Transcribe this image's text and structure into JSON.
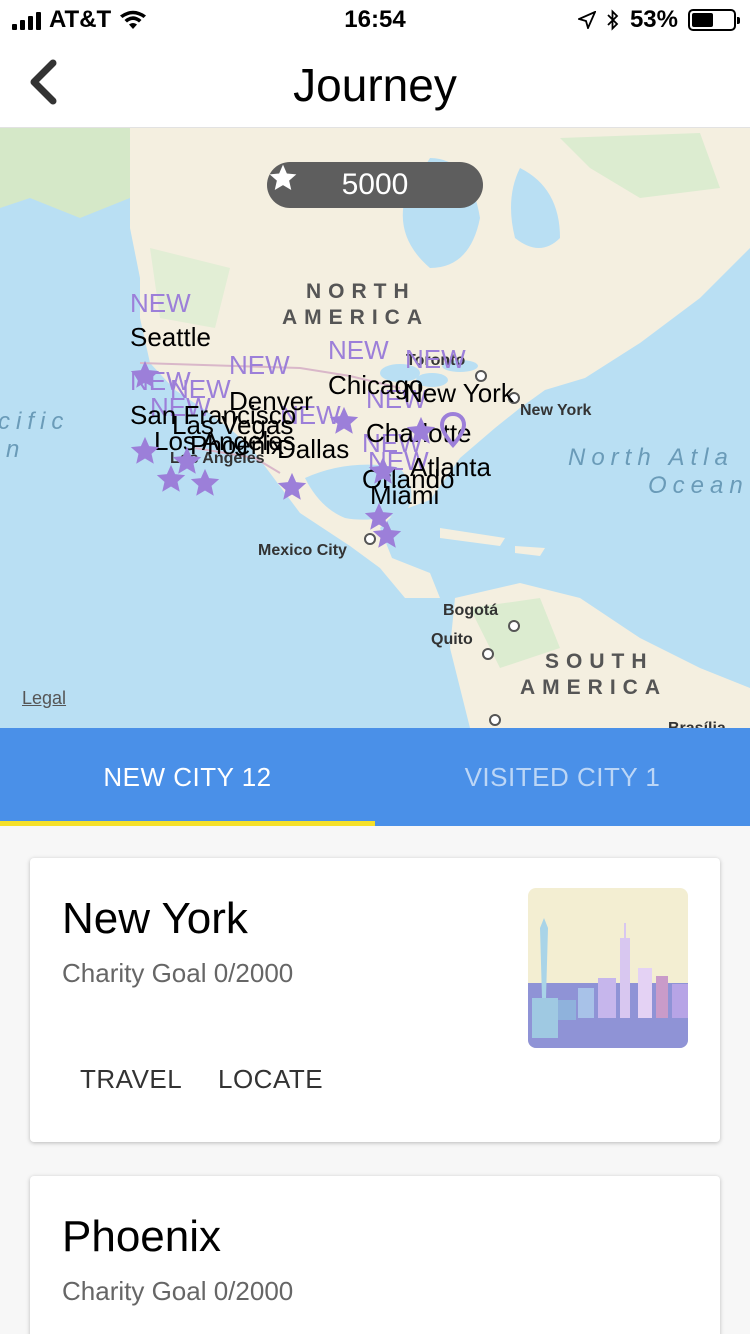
{
  "status_bar": {
    "carrier": "AT&T",
    "time": "16:54",
    "battery": "53%",
    "battery_level": 0.53
  },
  "nav": {
    "title": "Journey",
    "back_icon": "chevron-left-icon"
  },
  "map": {
    "stars_balance": "5000",
    "star_icon": "star-icon",
    "legal": "Legal",
    "regions": [
      "NORTH",
      "AMERICA",
      "SOUTH",
      "AMERICA"
    ],
    "oceans": [
      "cific",
      "n",
      "North Atla",
      "Ocean"
    ],
    "base_cities": [
      "Toronto",
      "New York",
      "Mexico City",
      "Bogotá",
      "Quito",
      "Los Angeles",
      "Brasília"
    ],
    "new_tag": "NEW",
    "journey_cities": [
      "Seattle",
      "San Francisco",
      "Las Vegas",
      "Los Angeles",
      "Phoenix",
      "Denver",
      "Dallas",
      "Chicago",
      "New York",
      "Charlotte",
      "Atlanta",
      "Orlando",
      "Miami"
    ],
    "marker_color": "#9c7fd9"
  },
  "tabs": [
    {
      "label": "NEW CITY 12",
      "active": true
    },
    {
      "label": "VISITED CITY 1",
      "active": false
    }
  ],
  "tab_indicator_color": "#f5e02a",
  "tab_bar_color": "#4a90e8",
  "cards": [
    {
      "title": "New York",
      "subtitle": "Charity Goal 0/2000",
      "actions": [
        "TRAVEL",
        "LOCATE"
      ]
    },
    {
      "title": "Phoenix",
      "subtitle": "Charity Goal 0/2000"
    }
  ]
}
